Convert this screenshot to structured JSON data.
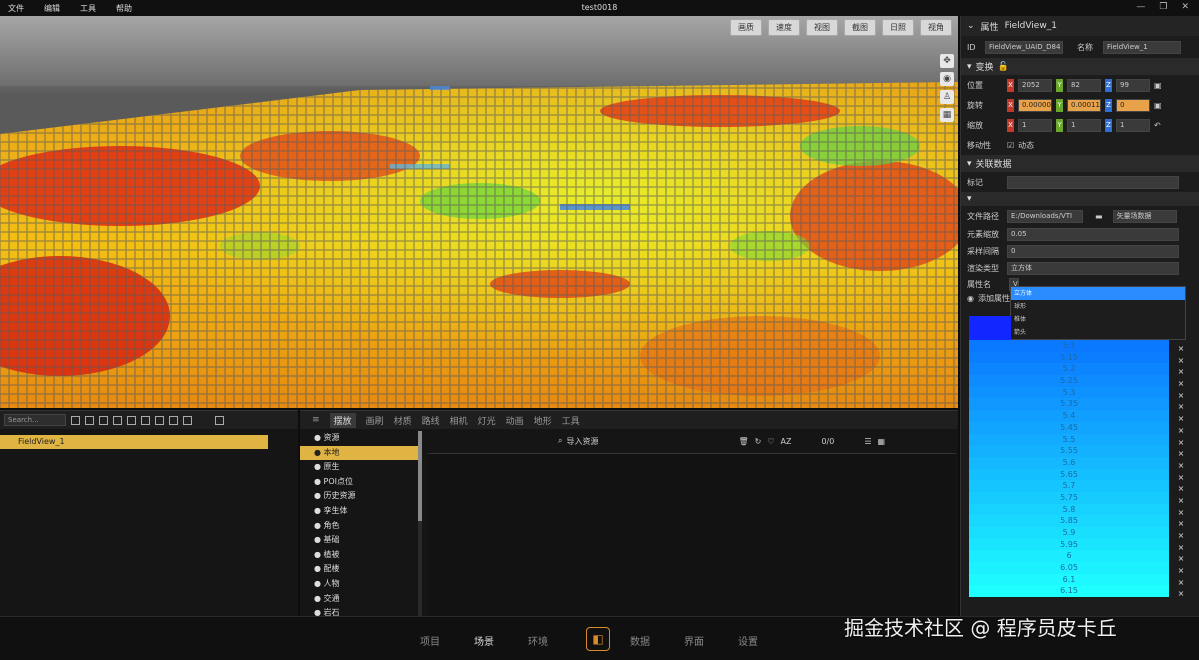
{
  "window": {
    "title": "test0018",
    "menu": [
      "文件",
      "编辑",
      "工具",
      "帮助"
    ]
  },
  "viewport": {
    "buttons": [
      "画质",
      "速度",
      "视图",
      "截图",
      "日照",
      "视角"
    ]
  },
  "properties": {
    "header": "属性",
    "object_name": "FieldView_1",
    "id_label": "ID",
    "id_value": "FieldView_UAID_D84",
    "name_label": "名称",
    "name_value": "FieldView_1",
    "transform_section": "变换",
    "position_label": "位置",
    "position": {
      "x": "2052",
      "y": "82",
      "z": "99"
    },
    "rotation_label": "旋转",
    "rotation": {
      "x": "0.000000",
      "y": "0.00011",
      "z": "0"
    },
    "scale_label": "缩放",
    "scale": {
      "x": "1",
      "y": "1",
      "z": "1"
    },
    "mobility_label": "移动性",
    "mobility_value": "动态",
    "assoc_section": "关联数据",
    "tag_label": "标记",
    "file_path_label": "文件路径",
    "file_path_value": "E:/Downloads/VTI",
    "field_type_value": "矢量场数据",
    "elem_scale_label": "元素缩放",
    "elem_scale_value": "0.05",
    "sample_interval_label": "采样间隔",
    "sample_interval_value": "0",
    "render_type_label": "渲染类型",
    "render_type_value": "立方体",
    "render_options": [
      "立方体",
      "球形",
      "椎体",
      "箭头"
    ],
    "attr_name_label": "属性名",
    "attr_name_value": "V",
    "add_attr_label": "添加属性",
    "ramp_values": [
      "5.1",
      "5.15",
      "5.2",
      "5.25",
      "5.3",
      "5.35",
      "5.4",
      "5.45",
      "5.5",
      "5.55",
      "5.6",
      "5.65",
      "5.7",
      "5.75",
      "5.8",
      "5.85",
      "5.9",
      "5.95",
      "6",
      "6.05",
      "6.1",
      "6.15"
    ]
  },
  "outliner": {
    "search_placeholder": "Search...",
    "item": "FieldView_1"
  },
  "content": {
    "tabs": [
      "摆放",
      "画刷",
      "材质",
      "路线",
      "相机",
      "灯光",
      "动画",
      "地形",
      "工具"
    ],
    "tree": [
      "资源",
      "本地",
      "原生",
      "POI点位",
      "历史资源",
      "孪生体",
      "角色",
      "基础",
      "植被",
      "配楼",
      "人物",
      "交通",
      "岩石"
    ],
    "import_label": "导入资源",
    "count": "0/0"
  },
  "bottom_nav": [
    "项目",
    "场景",
    "环境",
    "数据",
    "界面",
    "设置"
  ],
  "watermark": "掘金技术社区 @ 程序员皮卡丘"
}
